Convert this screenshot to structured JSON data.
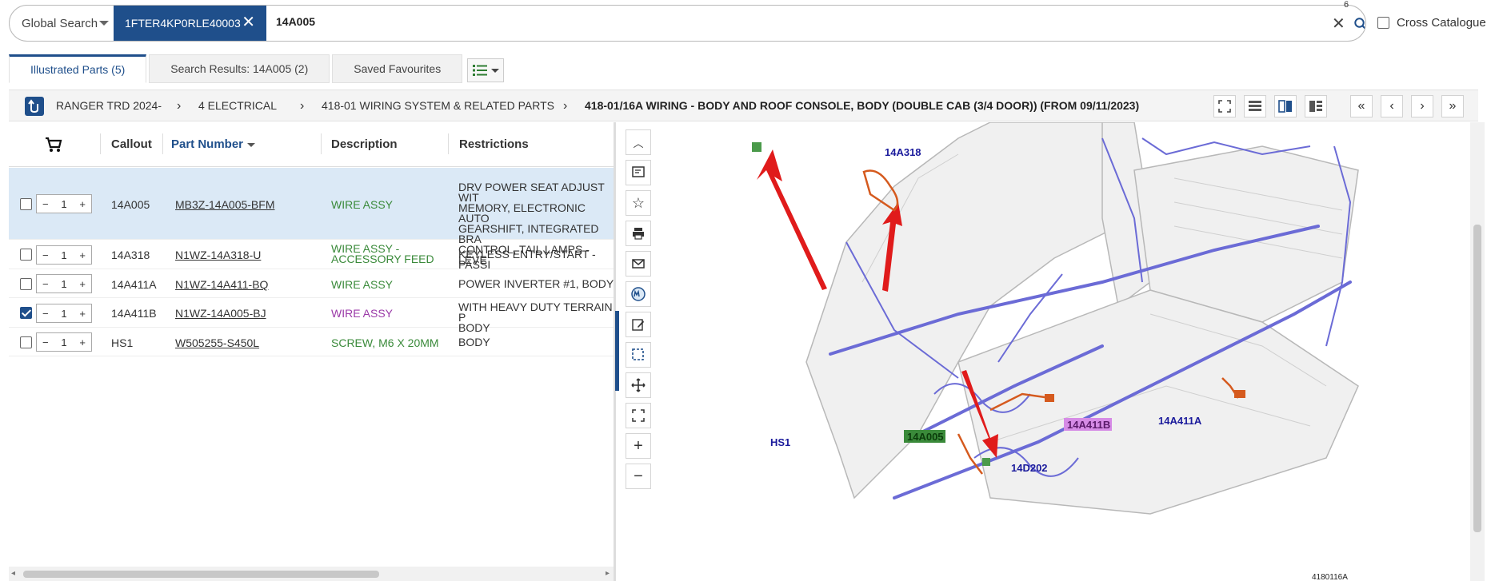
{
  "search": {
    "scope_label": "Global Search",
    "vin_chip": "1FTER4KP0RLE40003",
    "query": "14A005",
    "badge_count": "6",
    "cross_catalogue_label": "Cross Catalogue"
  },
  "tabs": [
    {
      "label": "Illustrated Parts (5)",
      "active": true
    },
    {
      "label": "Search Results: 14A005 (2)",
      "active": false
    },
    {
      "label": "Saved Favourites",
      "active": false
    }
  ],
  "breadcrumb": [
    "RANGER TRD 2024-",
    "4 ELECTRICAL",
    "418-01 WIRING SYSTEM & RELATED PARTS",
    "418-01/16A WIRING - BODY AND ROOF CONSOLE, BODY (DOUBLE CAB (3/4 DOOR)) (FROM 09/11/2023)"
  ],
  "table": {
    "headers": {
      "callout": "Callout",
      "part_number": "Part Number",
      "description": "Description",
      "restrictions": "Restrictions"
    },
    "rows": [
      {
        "checked": false,
        "qty": "1",
        "callout": "14A005",
        "part_number": "MB3Z-14A005-BFM",
        "description": "WIRE ASSY",
        "desc_color": "green",
        "restrictions": "DRV POWER SEAT ADJUST WIT\nMEMORY, ELECTRONIC AUTO\nGEARSHIFT, INTEGRATED BRA\nCONTROL, TAIL LAMPS - LEVE"
      },
      {
        "checked": false,
        "qty": "1",
        "callout": "14A318",
        "part_number": "N1WZ-14A318-U",
        "description": "WIRE ASSY -\nACCESSORY FEED",
        "desc_color": "green",
        "restrictions": "KEYLESS ENTRY/START - PASSI"
      },
      {
        "checked": false,
        "qty": "1",
        "callout": "14A411A",
        "part_number": "N1WZ-14A411-BQ",
        "description": "WIRE ASSY",
        "desc_color": "green",
        "restrictions": "POWER INVERTER #1, BODY"
      },
      {
        "checked": true,
        "qty": "1",
        "callout": "14A411B",
        "part_number": "N1WZ-14A005-BJ",
        "description": "WIRE ASSY",
        "desc_color": "purple",
        "restrictions": "WITH HEAVY DUTY TERRAIN P\nBODY"
      },
      {
        "checked": false,
        "qty": "1",
        "callout": "HS1",
        "part_number": "W505255-S450L",
        "description": "SCREW, M6 X 20MM",
        "desc_color": "green",
        "restrictions": "BODY"
      }
    ]
  },
  "diagram": {
    "labels": {
      "a318": "14A318",
      "a005": "14A005",
      "a411b": "14A411B",
      "a411a": "14A411A",
      "hs1": "HS1",
      "d202": "14D202",
      "ref": "4180116A"
    }
  },
  "colors": {
    "brand": "#1f4f8b",
    "selected_row": "#dbe9f6",
    "harness": "#6b6bd6",
    "arrow": "#e01b1b"
  }
}
